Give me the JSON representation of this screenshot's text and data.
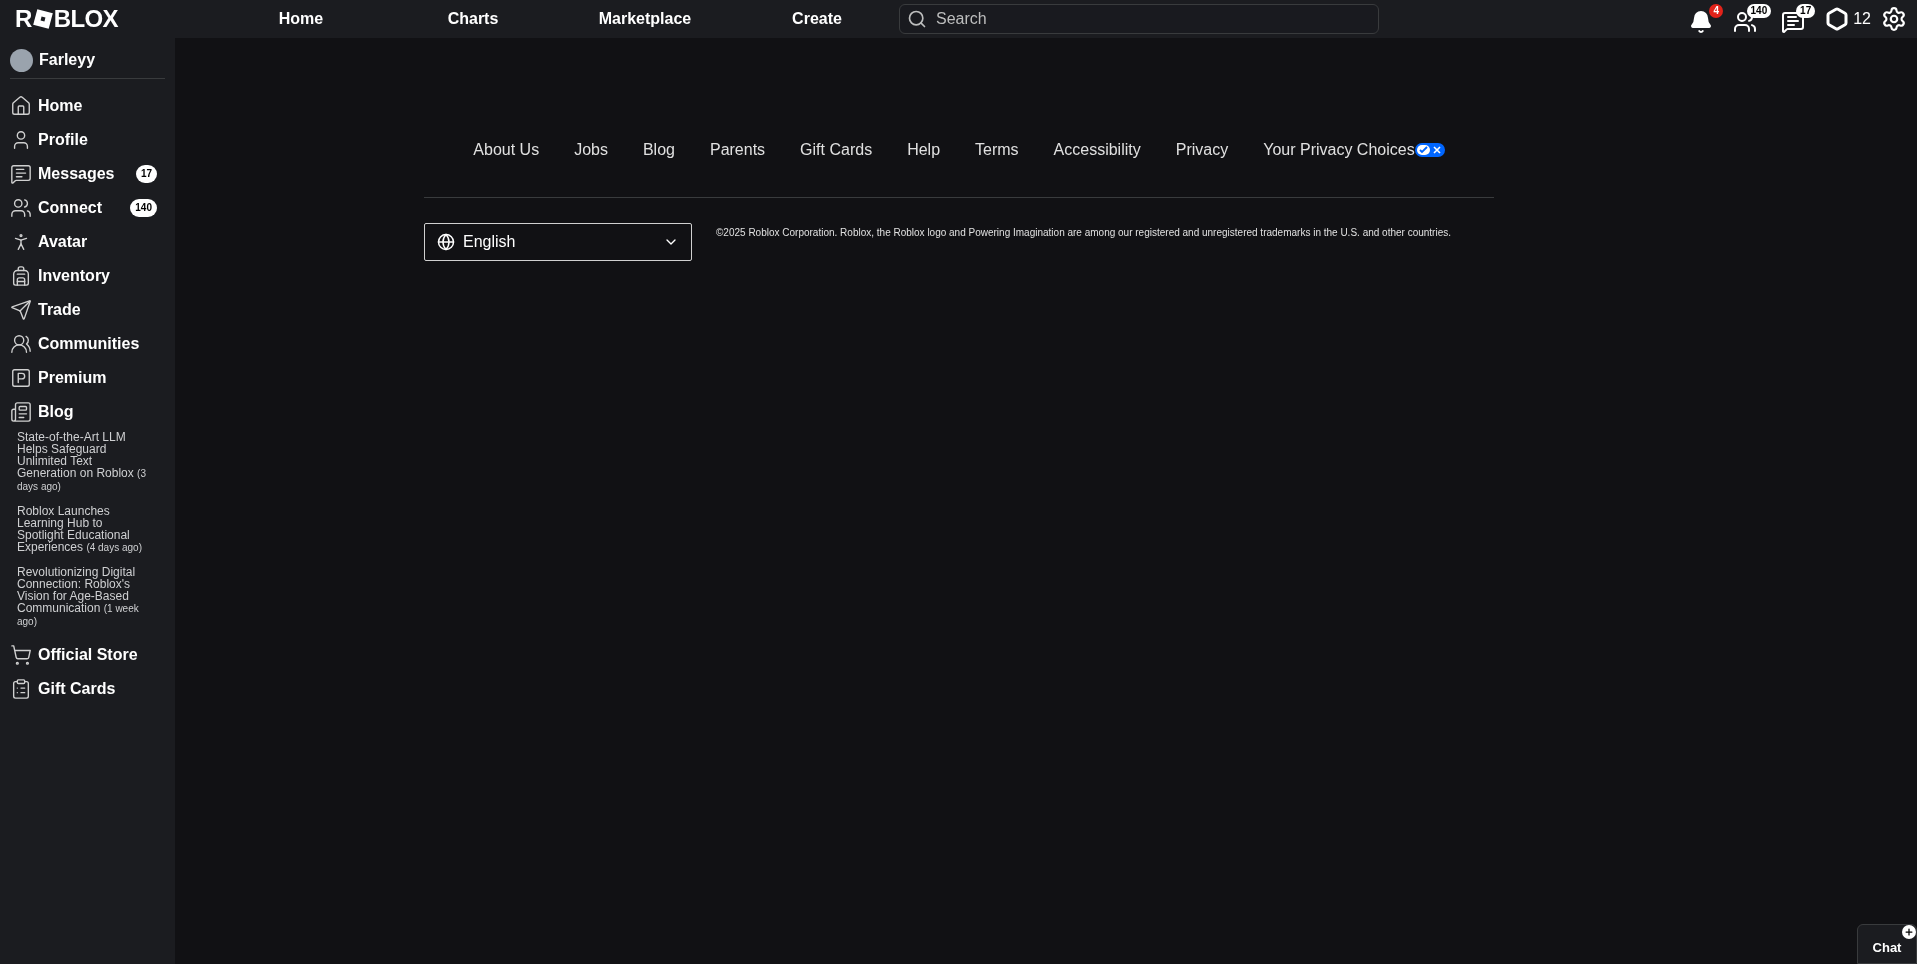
{
  "logo": {
    "before": "R",
    "after": "BLOX"
  },
  "top_nav": [
    "Home",
    "Charts",
    "Marketplace",
    "Create"
  ],
  "search": {
    "placeholder": "Search"
  },
  "header_icons": {
    "notifications_badge": "4",
    "friends_badge": "140",
    "messages_badge": "17",
    "robux": "12"
  },
  "user": {
    "name": "Farleyy"
  },
  "sidebar": {
    "items": [
      {
        "label": "Home"
      },
      {
        "label": "Profile"
      },
      {
        "label": "Messages",
        "badge": "17"
      },
      {
        "label": "Connect",
        "badge": "140"
      },
      {
        "label": "Avatar"
      },
      {
        "label": "Inventory"
      },
      {
        "label": "Trade"
      },
      {
        "label": "Communities"
      },
      {
        "label": "Premium"
      },
      {
        "label": "Blog"
      }
    ],
    "blog_posts": [
      {
        "title": "State-of-the-Art LLM Helps Safeguard Unlimited Text Generation on Roblox",
        "age": "(3 days ago)"
      },
      {
        "title": "Roblox Launches Learning Hub to Spotlight Educational Experiences",
        "age": "(4 days ago)"
      },
      {
        "title": "Revolutionizing Digital Connection: Roblox's Vision for Age-Based Communication",
        "age": "(1 week ago)"
      }
    ],
    "bottom_items": [
      {
        "label": "Official Store"
      },
      {
        "label": "Gift Cards"
      }
    ]
  },
  "footer": {
    "links": [
      "About Us",
      "Jobs",
      "Blog",
      "Parents",
      "Gift Cards",
      "Help",
      "Terms",
      "Accessibility",
      "Privacy",
      "Your Privacy Choices"
    ],
    "language": "English",
    "copyright": "©2025 Roblox Corporation. Roblox, the Roblox logo and Powering Imagination are among our registered and unregistered trademarks in the U.S. and other countries."
  },
  "chat": {
    "label": "Chat"
  }
}
